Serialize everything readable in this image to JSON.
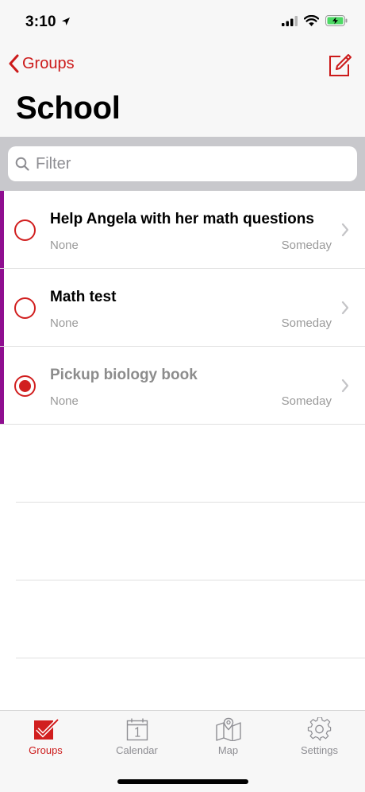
{
  "status": {
    "time": "3:10"
  },
  "nav": {
    "back_label": "Groups",
    "title": "School"
  },
  "filter": {
    "placeholder": "Filter"
  },
  "tasks": [
    {
      "title": "Help Angela with her math questions",
      "subtitle": "None",
      "date": "Someday",
      "completed": false
    },
    {
      "title": "Math test",
      "subtitle": "None",
      "date": "Someday",
      "completed": false
    },
    {
      "title": "Pickup biology book",
      "subtitle": "None",
      "date": "Someday",
      "completed": true
    }
  ],
  "tabs": [
    {
      "label": "Groups",
      "icon": "groups-icon",
      "active": true
    },
    {
      "label": "Calendar",
      "icon": "calendar-icon",
      "active": false
    },
    {
      "label": "Map",
      "icon": "map-icon",
      "active": false
    },
    {
      "label": "Settings",
      "icon": "settings-icon",
      "active": false
    }
  ],
  "colors": {
    "accent": "#cc1a1a",
    "group_stripe": "#8f0e90",
    "secondary_text": "#9a9a9a"
  }
}
